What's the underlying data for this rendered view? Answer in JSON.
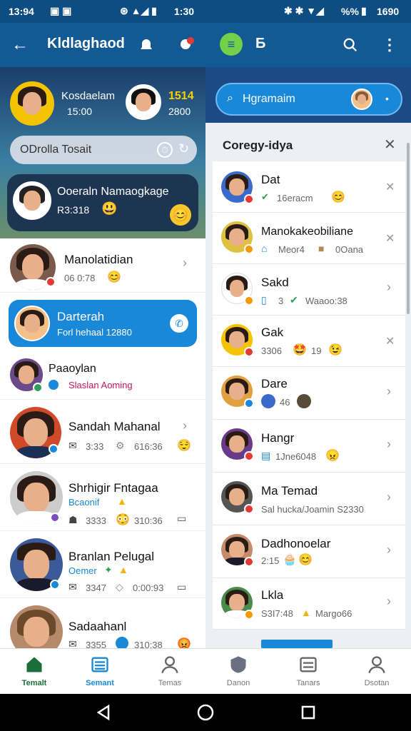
{
  "status_left": {
    "time": "13:94",
    "extra": "",
    "right_pct": "",
    "right_time": "1:30"
  },
  "status_right": {
    "pct": "%%",
    "time": "1690"
  },
  "left": {
    "title": "Kldlaghaod",
    "hero": {
      "name1": "Kosdaelam",
      "time1": "15:00",
      "num2": "1514",
      "time2": "2800",
      "search": "ODrolla Tosait",
      "card_name": "Ooeraln Namaogkage",
      "card_sub": "R3:318"
    },
    "items": [
      {
        "name": "Manolatidian",
        "sub": "06 0:78"
      },
      {
        "name": "Darterah",
        "sub": "Forl hehaal 12880"
      },
      {
        "name": "Paaoylan",
        "sub": "Slaslan Aoming"
      },
      {
        "name": "Sandah Mahanal",
        "sub_a": "3:33",
        "sub_b": "616:36"
      },
      {
        "name": "Shrhigir Fntagaa",
        "sub": "Bcaonif",
        "sub_a": "3333",
        "sub_b": "310:36"
      },
      {
        "name": "Branlan Pelugal",
        "sub": "Oemer",
        "sub_a": "3347",
        "sub_b": "0:00:93"
      },
      {
        "name": "Sadaahanl",
        "sub_a": "3355",
        "sub_b": "310:38"
      }
    ]
  },
  "right": {
    "title": "Б",
    "search": "Hgramaim",
    "panel_title": "Coregy-idya",
    "items": [
      {
        "name": "Dat",
        "sub": "16eracm"
      },
      {
        "name": "Manokakeobiliane",
        "sub_a": "Meor4",
        "sub_b": "0Oana"
      },
      {
        "name": "Sakd",
        "sub_a": "3",
        "sub_b": "Waaoo:38"
      },
      {
        "name": "Gak",
        "sub_a": "3306",
        "sub_b": "19"
      },
      {
        "name": "Dare",
        "sub": "46"
      },
      {
        "name": "Hangr",
        "sub": "1Jne6048"
      },
      {
        "name": "Ma Temad",
        "sub": "Sal hucka/Joamin S2330"
      },
      {
        "name": "Dadhonoelar",
        "sub": "2:15"
      },
      {
        "name": "Lkla",
        "sub_a": "S3I7:48",
        "sub_b": "Margo66"
      }
    ]
  },
  "nav": [
    {
      "label": "Temalt"
    },
    {
      "label": "Semant"
    },
    {
      "label": "Temas"
    },
    {
      "label": "Danon"
    },
    {
      "label": "Tanars"
    },
    {
      "label": "Dsotan"
    }
  ],
  "colors": {
    "primary": "#135a94",
    "accent": "#1a88d8",
    "active": "#1a6e3a"
  }
}
